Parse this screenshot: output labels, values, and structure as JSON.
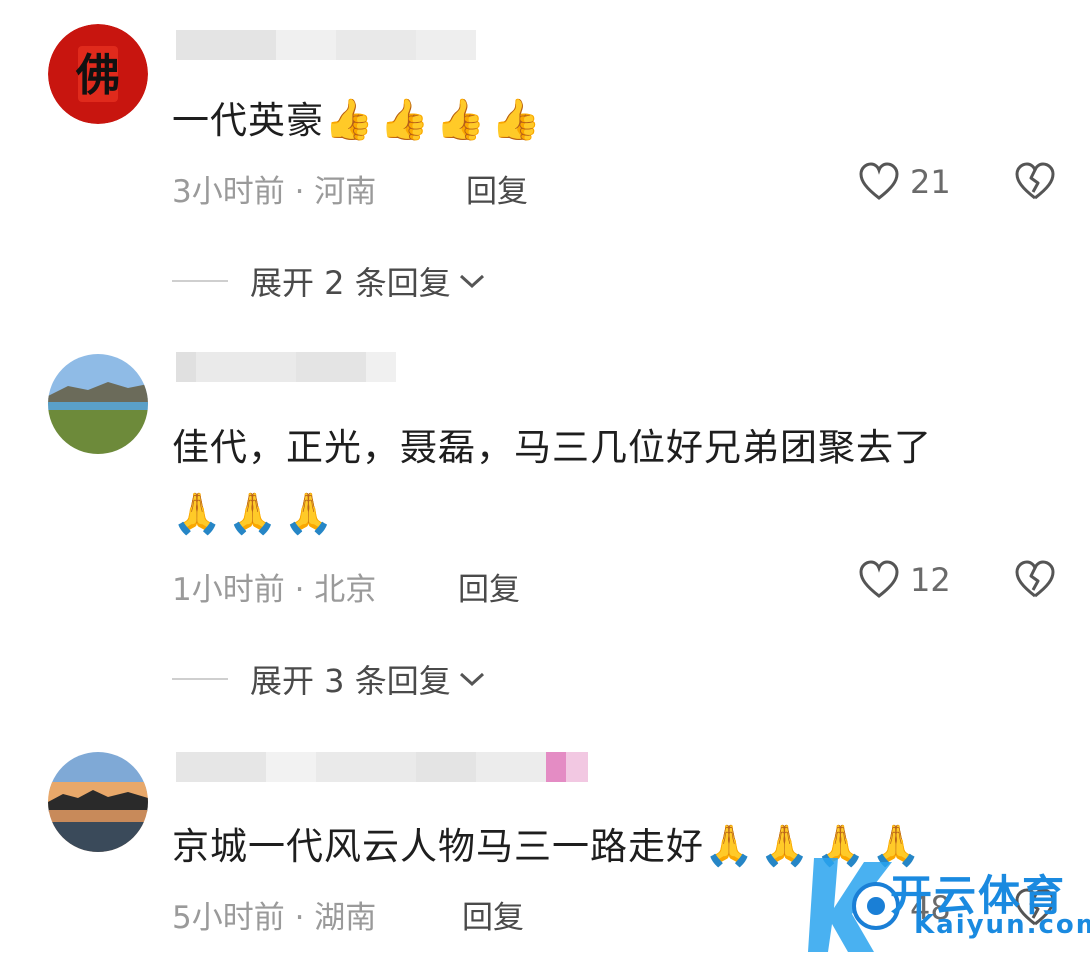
{
  "comments": [
    {
      "text": "一代英豪",
      "emoji": "👍👍👍👍",
      "time_location": "3小时前 · 河南",
      "reply_label": "回复",
      "likes": "21",
      "expand_label": "展开 2 条回复",
      "avatar_glyph": "佛"
    },
    {
      "text": "佳代，正光，聂磊，马三几位好兄弟团聚去了",
      "emoji": "🙏🙏🙏",
      "time_location": "1小时前 · 北京",
      "reply_label": "回复",
      "likes": "12",
      "expand_label": "展开 3 条回复"
    },
    {
      "text": "京城一代风云人物马三一路走好",
      "emoji": "🙏🙏🙏🙏",
      "time_location": "5小时前 · 湖南",
      "reply_label": "回复",
      "likes": "48"
    }
  ],
  "watermark": {
    "cn": "开云体育",
    "en": "Kaiyun.com"
  },
  "colors": {
    "meta": "#9a9a9a",
    "watermark": "#1a8ae0"
  }
}
